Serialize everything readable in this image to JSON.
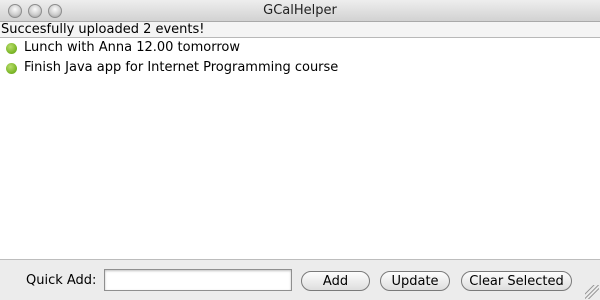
{
  "window": {
    "title": "GCalHelper"
  },
  "status": {
    "text": "Succesfully uploaded 2 events!"
  },
  "events": [
    {
      "label": "Lunch with Anna 12.00 tomorrow",
      "color": "#7fb92b"
    },
    {
      "label": "Finish Java app for Internet Programming course",
      "color": "#7fb92b"
    }
  ],
  "quick_add": {
    "label": "Quick Add:",
    "value": "",
    "placeholder": ""
  },
  "buttons": {
    "add": "Add",
    "update": "Update",
    "clear_selected": "Clear Selected"
  }
}
